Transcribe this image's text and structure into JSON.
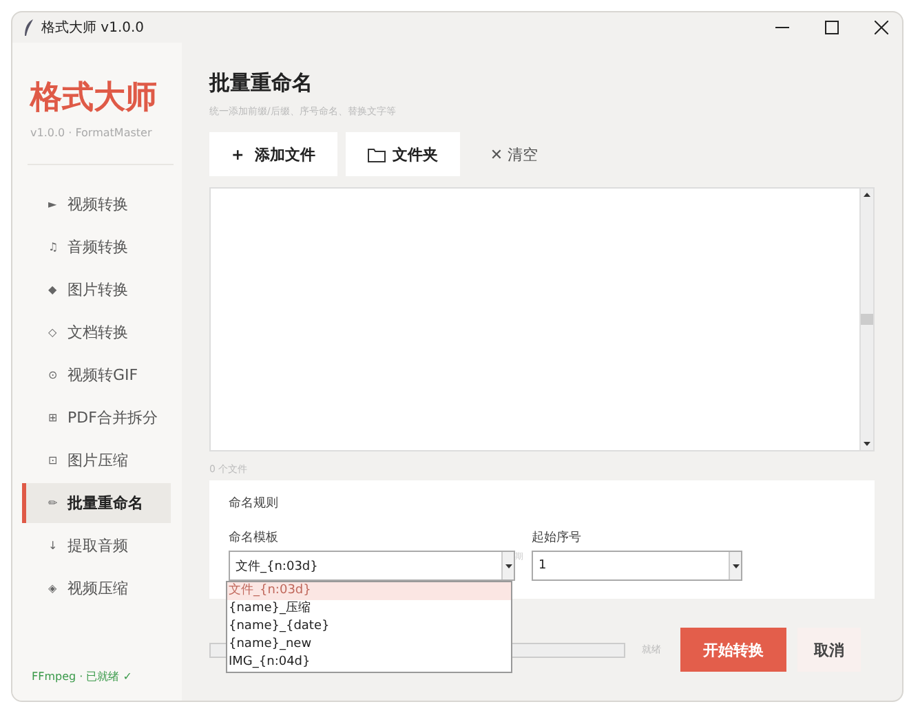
{
  "window": {
    "title": "格式大师 v1.0.0"
  },
  "sidebar": {
    "logo": "格式大师",
    "version": "v1.0.0 · FormatMaster",
    "items": [
      {
        "icon": "►",
        "label": "视频转换",
        "selected": false
      },
      {
        "icon": "♫",
        "label": "音频转换",
        "selected": false
      },
      {
        "icon": "◆",
        "label": "图片转换",
        "selected": false
      },
      {
        "icon": "◇",
        "label": "文档转换",
        "selected": false
      },
      {
        "icon": "⊙",
        "label": "视频转GIF",
        "selected": false
      },
      {
        "icon": "⊞",
        "label": "PDF合并拆分",
        "selected": false
      },
      {
        "icon": "⊡",
        "label": "图片压缩",
        "selected": false
      },
      {
        "icon": "✏",
        "label": "批量重命名",
        "selected": true
      },
      {
        "icon": "↓",
        "label": "提取音频",
        "selected": false
      },
      {
        "icon": "◈",
        "label": "视频压缩",
        "selected": false
      }
    ],
    "status": "FFmpeg · 已就绪 ✓"
  },
  "page": {
    "title": "批量重命名",
    "subtitle": "统一添加前缀/后缀、序号命名、替换文字等"
  },
  "toolbar": [
    {
      "kind": "add",
      "label": "添加文件",
      "icon": "+"
    },
    {
      "kind": "folder",
      "label": "文件夹"
    },
    {
      "kind": "clear",
      "label": "清空",
      "icon": "✕"
    }
  ],
  "file_count": "0 个文件",
  "rules": {
    "title": "命名规则",
    "template_label": "命名模板",
    "template_value": "文件_{n:03d}",
    "hidden_hint": "期",
    "start_label": "起始序号",
    "start_value": "1",
    "options": [
      {
        "label": "文件_{n:03d}",
        "selected": true
      },
      {
        "label": "{name}_压缩",
        "selected": false
      },
      {
        "label": "{name}_{date}",
        "selected": false
      },
      {
        "label": "{name}_new",
        "selected": false
      },
      {
        "label": "IMG_{n:04d}",
        "selected": false
      }
    ]
  },
  "progress": {
    "level": 0,
    "status": "就绪"
  },
  "buttons": {
    "start": "开始转换",
    "cancel": "取消"
  }
}
